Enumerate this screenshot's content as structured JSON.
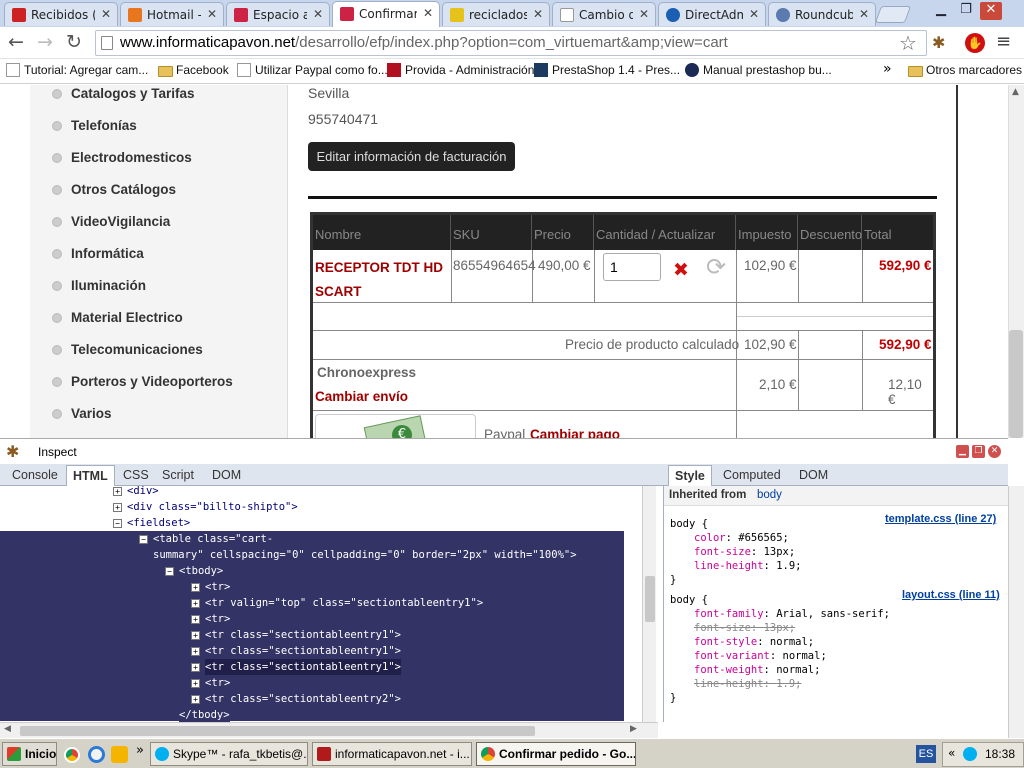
{
  "browser": {
    "tabs": [
      {
        "label": "Recibidos (",
        "color": "#cc2222"
      },
      {
        "label": "Hotmail - r",
        "color": "#e8761e"
      },
      {
        "label": "Espacio al c",
        "color": "#cc2244"
      },
      {
        "label": "Confirmar p",
        "color": "#cc2244"
      },
      {
        "label": "reciclados",
        "color": "#e6c31a"
      },
      {
        "label": "Cambio de",
        "color": "#d0d0d0"
      },
      {
        "label": "DirectAdmi",
        "color": "#1a5fb4"
      },
      {
        "label": "Roundcube",
        "color": "#5a7ab0"
      }
    ],
    "url_domain": "www.informaticapavon.net",
    "url_path": "/desarrollo/efp/index.php?option=com_virtuemart&amp;view=cart",
    "bookmarks": [
      "Tutorial: Agregar cam...",
      "Facebook",
      "Utilizar Paypal como fo...",
      "Provida - Administración",
      "PrestaShop 1.4 - Pres...",
      "Manual prestashop bu..."
    ],
    "overflow_chevron": "»",
    "other_bookmarks": "Otros marcadores"
  },
  "sidebar": {
    "items": [
      "Catalogos y Tarifas",
      "Telefonías",
      "Electrodomesticos",
      "Otros Catálogos",
      "VideoVigilancia",
      "Informática",
      "Iluminación",
      "Material Electrico",
      "Telecomunicaciones",
      "Porteros y Videoporteros",
      "Varios"
    ]
  },
  "billing": {
    "city": "Sevilla",
    "phone": "955740471",
    "edit_button": "Editar información de facturación"
  },
  "cart": {
    "headers": [
      "Nombre",
      "SKU",
      "Precio",
      "Cantidad / Actualizar",
      "Impuesto",
      "Descuento",
      "Total"
    ],
    "product": {
      "name_line1": "RECEPTOR TDT HD",
      "name_line2": "SCART",
      "sku": "86554964654",
      "price": "490,00 €",
      "quantity": "1",
      "tax": "102,90 €",
      "total": "592,90 €"
    },
    "subtotal_label": "Precio de producto calculado",
    "subtotal_tax": "102,90 €",
    "subtotal_total": "592,90 €",
    "shipping_name": "Chronoexpress",
    "shipping_change": "Cambiar envío",
    "shipping_tax": "2,10 €",
    "shipping_total": "12,10 €",
    "payment_name": "Paypal",
    "payment_change": "Cambiar pago"
  },
  "firebug": {
    "title": "Inspect",
    "tabs": [
      "Console",
      "HTML",
      "CSS",
      "Script",
      "DOM"
    ],
    "side_tabs": [
      "Style",
      "Computed",
      "DOM"
    ],
    "inherited_label": "Inherited from",
    "inherited_elem": "body",
    "html_lines": [
      "<div>",
      "<div class=\"billto-shipto\">",
      "<fieldset>",
      "<table class=\"cart-",
      "summary\" cellspacing=\"0\" cellpadding=\"0\" border=\"2px\" width=\"100%\">",
      "<tbody>",
      "<tr>",
      "<tr valign=\"top\" class=\"sectiontableentry1\">",
      "<tr>",
      "<tr class=\"sectiontableentry1\">",
      "<tr class=\"sectiontableentry1\">",
      "<tr class=\"sectiontableentry1\">",
      "<tr>",
      "<tr class=\"sectiontableentry2\">",
      "</tbody>"
    ],
    "rules": [
      {
        "selector": "body {",
        "source": "template.css (line 27)",
        "props": [
          {
            "n": "color",
            "v": "#656565;"
          },
          {
            "n": "font-size",
            "v": "13px;"
          },
          {
            "n": "line-height",
            "v": "1.9;"
          }
        ]
      },
      {
        "selector": "body {",
        "source": "layout.css (line 11)",
        "props": [
          {
            "n": "font-family",
            "v": "Arial, sans-serif;"
          },
          {
            "n": "font-size",
            "v": "13px;"
          },
          {
            "n": "font-style",
            "v": "normal;"
          },
          {
            "n": "font-variant",
            "v": "normal;"
          },
          {
            "n": "font-weight",
            "v": "normal;"
          },
          {
            "n": "line-height",
            "v": "1.9;"
          }
        ]
      }
    ]
  },
  "taskbar": {
    "start": "Inicio",
    "items": [
      "Skype™ - rafa_tkbetis@...",
      "informaticapavon.net - i...",
      "Confirmar pedido - Go..."
    ],
    "language": "ES",
    "clock": "18:38"
  }
}
